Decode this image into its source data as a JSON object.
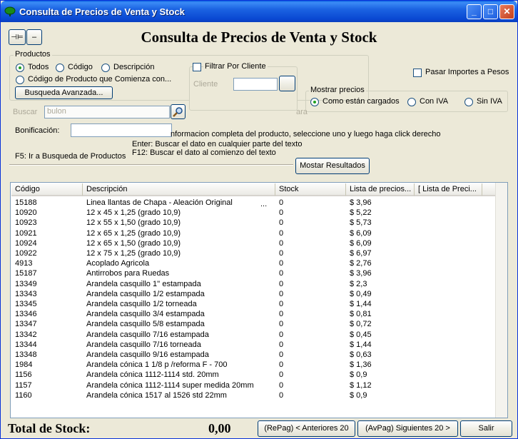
{
  "window": {
    "title": "Consulta de Precios de Venta y Stock",
    "minimize": "_",
    "maximize": "□",
    "close": "✕",
    "icon": "green-leaf-icon"
  },
  "toolbar": {
    "pin_icon": "pin-icon",
    "pin_label": "⊣⊨",
    "collapse_label": "–"
  },
  "header": {
    "title": "Consulta de Precios de Venta y Stock"
  },
  "productos": {
    "title": "Productos",
    "todos": "Todos",
    "codigo": "Código",
    "descripcion": "Descripción",
    "codigo_comienza": "Código de Producto que Comienza con...",
    "busqueda_avanzada": "Busqueda Avanzada..."
  },
  "filtro": {
    "title": "Filtrar Por Cliente",
    "cliente_label": "Cliente",
    "cliente_value": "",
    "cliente_btn": ""
  },
  "pasar_importes": "Pasar Importes a Pesos",
  "mostrar_precios": {
    "title": "Mostrar precios",
    "como_estan": "Como están cargados",
    "con_iva": "Con IVA",
    "sin_iva": "Sin IVA"
  },
  "buscar": {
    "label": "Buscar",
    "value": "bulon",
    "search_icon": "search-icon",
    "fragment": "ara"
  },
  "bonificacion": {
    "label": "Bonificación:",
    "value": ""
  },
  "help": {
    "line1": "nformacion completa del producto, seleccione uno y luego haga click derecho",
    "line2": "Enter: Buscar el dato en cualquier parte del texto",
    "line3": "F12: Buscar el dato al comienzo del texto",
    "f5": "F5: Ir a Busqueda de Productos"
  },
  "mostrar_resultados": "Mostar Resultados",
  "grid": {
    "headers": [
      "Código",
      "Descripción",
      "Stock",
      "Lista de precios...",
      "[ Lista de Preci..."
    ],
    "rows": [
      [
        "15188",
        " Linea llantas de Chapa - Aleación Original",
        "0",
        "$ 3,96"
      ],
      [
        "10920",
        "12 x 45 x 1,25 (grado 10,9)",
        "0",
        "$ 5,22"
      ],
      [
        "10923",
        "12 x 55 x 1,50 (grado 10,9)",
        "0",
        "$ 5,73"
      ],
      [
        "10921",
        "12 x 65 x 1,25 (grado 10,9)",
        "0",
        "$ 6,09"
      ],
      [
        "10924",
        "12 x 65 x 1,50 (grado 10,9)",
        "0",
        "$ 6,09"
      ],
      [
        "10922",
        "12 x 75 x 1,25 (grado 10,9)",
        "0",
        "$ 6,97"
      ],
      [
        "4913",
        "Acoplado Agricola",
        "0",
        "$ 2,76"
      ],
      [
        "15187",
        "Antirrobos para Ruedas",
        "0",
        "$ 3,96"
      ],
      [
        "13349",
        "Arandela casquillo 1'' estampada",
        "0",
        "$ 2,3"
      ],
      [
        "13343",
        "Arandela casquillo 1/2 estampada",
        "0",
        "$ 0,49"
      ],
      [
        "13345",
        "Arandela casquillo 1/2 torneada",
        "0",
        "$ 1,44"
      ],
      [
        "13346",
        "Arandela casquillo 3/4 estampada",
        "0",
        "$ 0,81"
      ],
      [
        "13347",
        "Arandela casquillo 5/8 estampada",
        "0",
        "$ 0,72"
      ],
      [
        "13342",
        "Arandela casquillo 7/16 estampada",
        "0",
        "$ 0,45"
      ],
      [
        "13344",
        "Arandela casquillo 7/16 torneada",
        "0",
        "$ 1,44"
      ],
      [
        "13348",
        "Arandela casquillo 9/16 estampada",
        "0",
        "$ 0,63"
      ],
      [
        "1984",
        "Arandela cónica 1 1/8 p /reforma F - 700",
        "0",
        "$ 1,36"
      ],
      [
        "1156",
        "Arandela cónica 1112-1114 std. 20mm",
        "0",
        "$ 0,9"
      ],
      [
        "1157",
        "Arandela cónica 1112-1114 super medida 20mm",
        "0",
        "$ 1,12"
      ],
      [
        "1160",
        "Arandela cónica 1517 al 1526 std 22mm",
        "0",
        "$ 0,9"
      ]
    ],
    "ellipsis": "..."
  },
  "footer": {
    "total_label": "Total de Stock:",
    "total_value": "0,00",
    "anteriores": "(RePag) < Anteriores 20",
    "siguientes": "(AvPag) Siguientes 20 >",
    "salir": "Salir"
  }
}
